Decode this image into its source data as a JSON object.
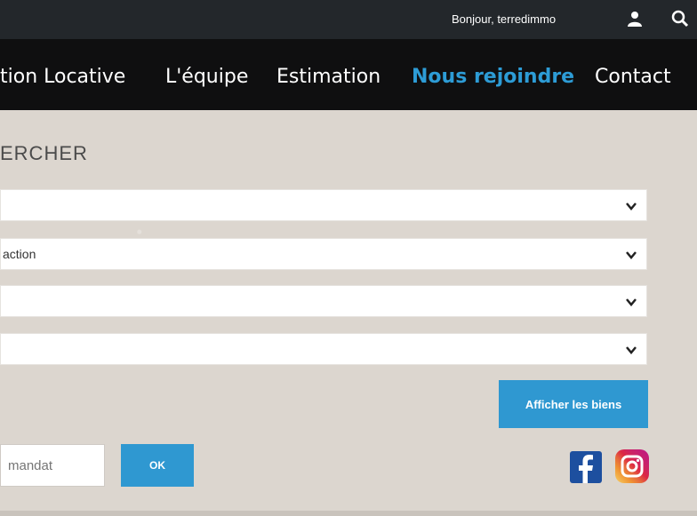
{
  "header": {
    "greeting": "Bonjour, terredimmo",
    "user_icon": "user-icon",
    "search_icon": "search-icon"
  },
  "nav": {
    "items": [
      {
        "label": "tion Locative",
        "active": false
      },
      {
        "label": "L'équipe",
        "active": false
      },
      {
        "label": "Estimation",
        "active": false
      },
      {
        "label": "Nous rejoindre",
        "active": true
      },
      {
        "label": "Contact",
        "active": false
      }
    ],
    "active_color": "#2d9cd6"
  },
  "search": {
    "title": "ERCHER",
    "selects": [
      {
        "value": ""
      },
      {
        "value": "action"
      },
      {
        "value": ""
      },
      {
        "value": ""
      }
    ],
    "submit_label": "Afficher les biens"
  },
  "mandate": {
    "placeholder": "mandat",
    "ok_label": "OK"
  },
  "social": {
    "facebook_icon": "facebook-icon",
    "instagram_icon": "instagram-icon"
  },
  "colors": {
    "primary": "#2f98d1",
    "top_bar": "#23272b",
    "nav_bar": "#0f0f10"
  }
}
